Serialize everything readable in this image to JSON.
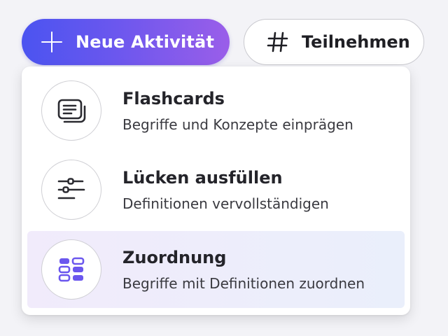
{
  "toolbar": {
    "new_activity_label": "Neue Aktivität",
    "new_activity_icon": "plus-icon",
    "join_label": "Teilnehmen",
    "join_icon": "hash-icon"
  },
  "colors": {
    "primary_gradient_start": "#4b54f0",
    "primary_gradient_end": "#9a5ee9",
    "selected_icon": "#6b57ee",
    "selected_item_bg": "#f1ebfb"
  },
  "menu": {
    "items": [
      {
        "title": "Flashcards",
        "description": "Begriffe und Konzepte einprägen",
        "icon": "flashcards-icon",
        "selected": false
      },
      {
        "title": "Lücken ausfüllen",
        "description": "Definitionen vervollständigen",
        "icon": "fill-in-blank-icon",
        "selected": false
      },
      {
        "title": "Zuordnung",
        "description": "Begriffe mit Definitionen zuordnen",
        "icon": "matching-grid-icon",
        "selected": true
      }
    ]
  }
}
